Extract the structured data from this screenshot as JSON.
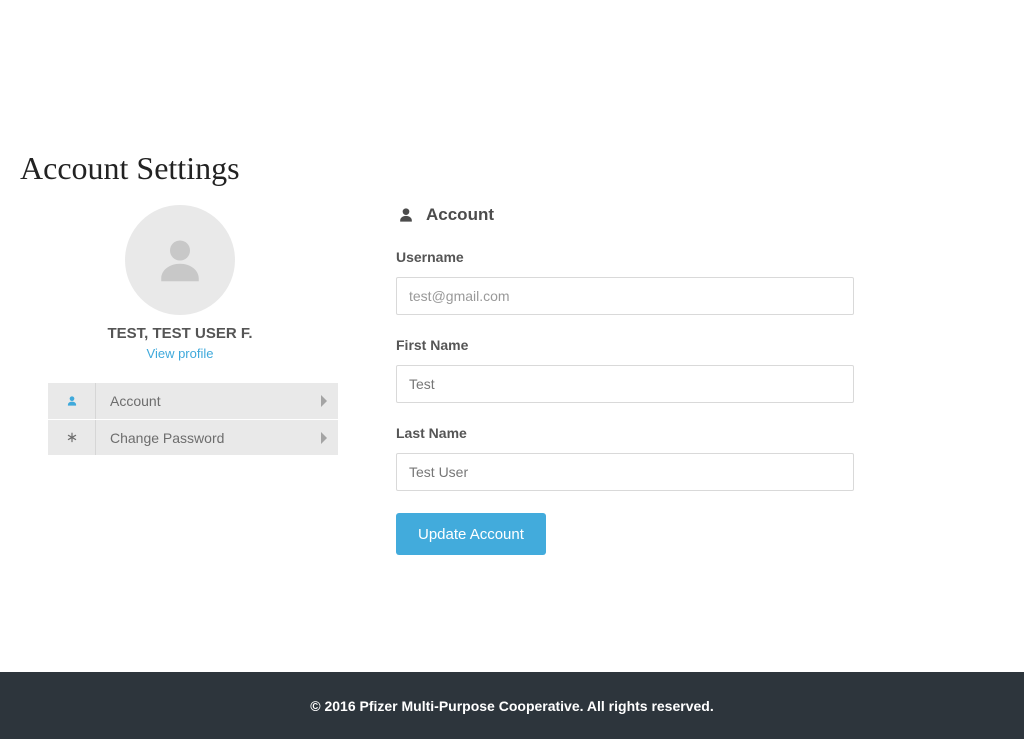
{
  "page": {
    "title": "Account Settings"
  },
  "profile": {
    "name": "TEST, TEST USER F.",
    "view_link": "View profile"
  },
  "nav": {
    "items": [
      {
        "label": "Account",
        "icon": "user",
        "active": true
      },
      {
        "label": "Change Password",
        "icon": "asterisk",
        "active": false
      }
    ]
  },
  "section": {
    "heading": "Account"
  },
  "form": {
    "username": {
      "label": "Username",
      "placeholder": "test@gmail.com",
      "value": ""
    },
    "firstname": {
      "label": "First Name",
      "value": "Test"
    },
    "lastname": {
      "label": "Last Name",
      "value": "Test User"
    },
    "submit_label": "Update Account"
  },
  "footer": {
    "text": "© 2016 Pfizer Multi-Purpose Cooperative. All rights reserved."
  }
}
